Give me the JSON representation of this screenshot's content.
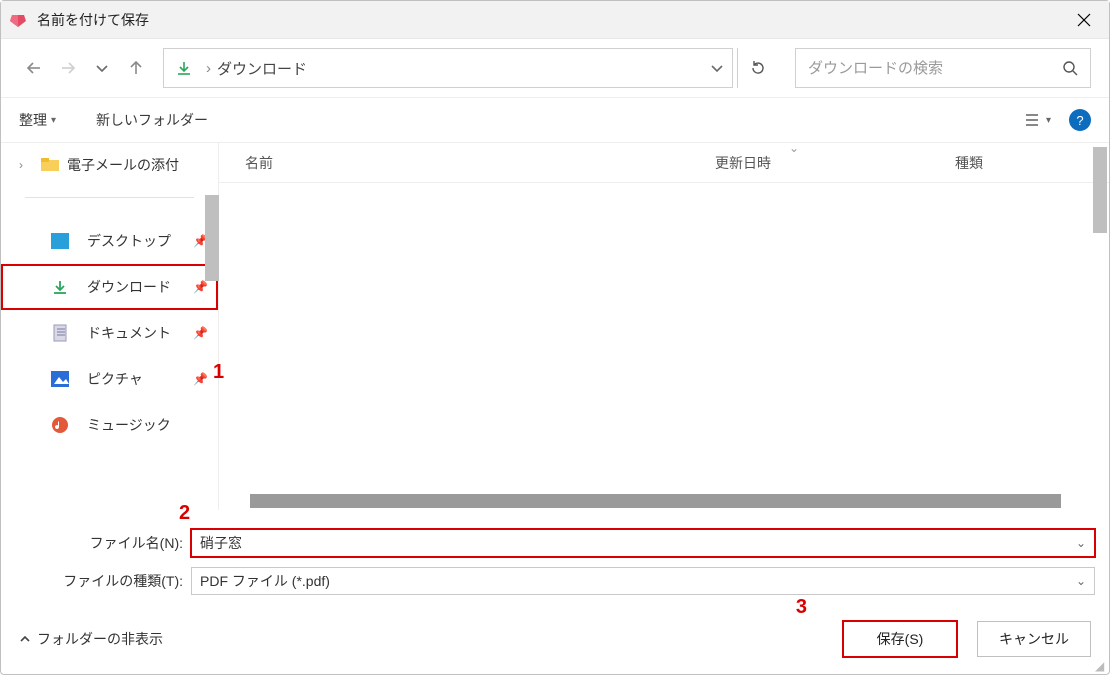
{
  "title": "名前を付けて保存",
  "nav": {
    "breadcrumb": "ダウンロード"
  },
  "search": {
    "placeholder": "ダウンロードの検索"
  },
  "toolbar": {
    "organize": "整理",
    "new_folder": "新しいフォルダー"
  },
  "columns": {
    "name": "名前",
    "modified": "更新日時",
    "type": "種類"
  },
  "side": {
    "attachments": "電子メールの添付",
    "desktop": "デスクトップ",
    "downloads": "ダウンロード",
    "documents": "ドキュメント",
    "pictures": "ピクチャ",
    "music": "ミュージック"
  },
  "form": {
    "filename_label": "ファイル名(N):",
    "filename_value": "硝子窓",
    "filetype_label": "ファイルの種類(T):",
    "filetype_value": "PDF ファイル (*.pdf)"
  },
  "footer": {
    "hide_folders": "フォルダーの非表示",
    "save": "保存(S)",
    "cancel": "キャンセル"
  },
  "markers": {
    "one": "1",
    "two": "2",
    "three": "3"
  }
}
